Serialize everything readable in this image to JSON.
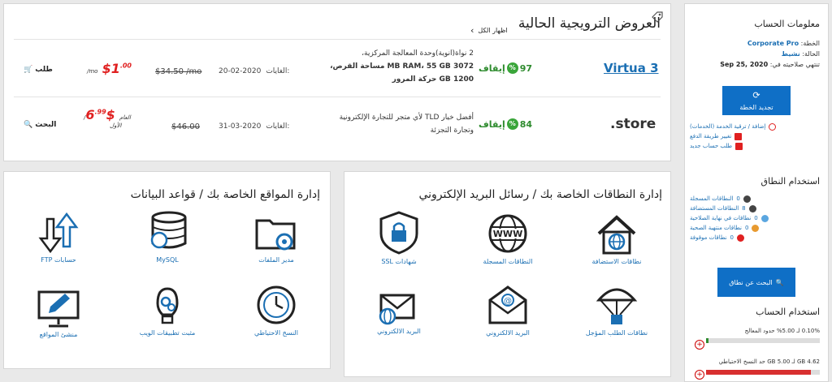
{
  "promo": {
    "title": "العروض الترويجية الحالية",
    "show_all": "اظهار الكل",
    "rows": [
      {
        "brand": "Virtua 3",
        "discount": "97",
        "discount_label": "إيقاف",
        "desc_line1": "2 نواة(انوية)وحدة المعالجة المركزية،",
        "desc_line2": "3072 MB RAM، 55 GB مساحة القرص،",
        "desc_line3": "1200 GB حركة المرور",
        "until_label": "الغايات:",
        "until_date": "20-02-2020",
        "old_price": "$34.50 /mo",
        "new_price": "$1",
        "new_price_cents": ".00",
        "unit": "/mo",
        "unit2": "",
        "order": "طلب"
      },
      {
        "brand": ".store",
        "discount": "84",
        "discount_label": "إيقاف",
        "desc_line1": "أفضل خيار TLD لأي متجر للتجارة الإلكترونية",
        "desc_line2": "وتجارة التجزئة",
        "desc_line3": "",
        "until_label": "الغايات:",
        "until_date": "31-03-2020",
        "old_price": "$46.00",
        "new_price": "$6",
        "new_price_cents": ".99",
        "unit": "/العام",
        "unit2": "الأول",
        "order": "البحث"
      }
    ]
  },
  "account": {
    "title": "معلومات الحساب",
    "plan_label": "الخطة:",
    "plan_value": "Corporate Pro",
    "status_label": "الحالة:",
    "status_value": "نشيط",
    "expires_label": "تنتهي صلاحيته في:",
    "expires_value": "Sep 25, 2020",
    "renew_button": "تجديد الخطة",
    "links": [
      {
        "label": "إضافة / ترقية الخدمة (الخدمات)",
        "color": "#e02020"
      },
      {
        "label": "تغيير طريقة الدفع",
        "color": "#e02020"
      },
      {
        "label": "طلب حساب جديد",
        "color": "#e02020"
      }
    ],
    "domain_usage_title": "استخدام النطاق",
    "domain_usage": [
      {
        "count": "0",
        "label": "النطاقات المسجلة",
        "color": "#444"
      },
      {
        "count": "8",
        "label": "النطاقات المستضافة",
        "color": "#444"
      },
      {
        "count": "0",
        "label": "نطاقات في نهاية الصلاحية",
        "color": "#5aa6e0"
      },
      {
        "count": "0",
        "label": "نطاقات منتهية الصحية",
        "color": "#e89a30"
      },
      {
        "count": "0",
        "label": "نطاقات موقوفة",
        "color": "#e02020"
      }
    ],
    "search_button": "البحث عن نطاق",
    "account_usage_title": "استخدام الحساب",
    "usage": [
      {
        "text": "0.10% لـ 5.00% حدود المعالج",
        "fraction": 0.02
      },
      {
        "text": "4.62 GB لـ 5.00 GB حد النسخ الاحتياطي",
        "fraction": 0.92
      }
    ]
  },
  "domains_panel": {
    "title": "إدارة النطاقات الخاصة بك / رسائل البريد الإلكتروني",
    "tiles": [
      {
        "label": "نطاقات الاستضافة",
        "icon": "house-globe-icon"
      },
      {
        "label": "النطاقات المسجلة",
        "icon": "www-globe-icon"
      },
      {
        "label": "شهادات SSL",
        "icon": "ssl-shield-icon"
      },
      {
        "label": "نطاقات الطلب المؤجل",
        "icon": "parachute-icon"
      },
      {
        "label": "البريد الالكتروني",
        "icon": "email-at-icon"
      },
      {
        "label": "البريد الالكتروني",
        "icon": "email-globe-icon"
      }
    ]
  },
  "sites_panel": {
    "title": "إدارة المواقع الخاصة بك / قواعد البيانات",
    "tiles": [
      {
        "label": "مدير الملفات",
        "icon": "folder-gear-icon"
      },
      {
        "label": "MySQL",
        "icon": "database-icon"
      },
      {
        "label": "حسابات FTP",
        "icon": "ftp-arrows-icon"
      },
      {
        "label": "النسخ الاحتياطي",
        "icon": "backup-clock-icon"
      },
      {
        "label": "مثبت تطبيقات الويب",
        "icon": "bulb-gears-icon"
      },
      {
        "label": "منشئ المواقع",
        "icon": "monitor-pencil-icon"
      }
    ]
  }
}
